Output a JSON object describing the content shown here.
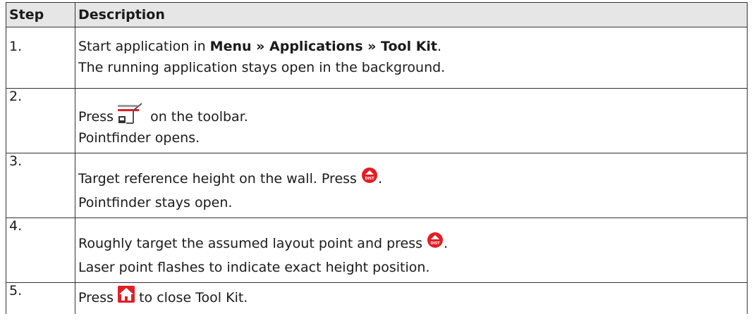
{
  "table": {
    "headers": {
      "step": "Step",
      "description": "Description"
    },
    "rows": [
      {
        "step": "1.",
        "line1_pre": "Start application in ",
        "line1_bold": "Menu » Applications » Tool Kit",
        "line1_post": ".",
        "line2": "The running application stays open in the background."
      },
      {
        "step": "2.",
        "line1_pre": "Press ",
        "icon": "pointfinder-toolbar-icon",
        "line1_post": " on the toolbar.",
        "line2": "Pointfinder opens."
      },
      {
        "step": "3.",
        "line1_pre": "Target reference height on the wall. Press ",
        "icon": "dist-button-icon",
        "line1_post": ".",
        "line2": "Pointfinder stays open."
      },
      {
        "step": "4.",
        "line1_pre": "Roughly target the assumed layout point and press ",
        "icon": "dist-button-icon",
        "line1_post": ".",
        "line2": "Laser point flashes to indicate exact height position."
      },
      {
        "step": "5.",
        "line1_pre": "Press ",
        "icon": "home-icon",
        "line1_post": " to close Tool Kit."
      }
    ]
  },
  "colors": {
    "accent_red": "#e31e24",
    "header_bg": "#e6e6e6",
    "border": "#333333"
  },
  "icon_text": {
    "dist": "DIST"
  }
}
